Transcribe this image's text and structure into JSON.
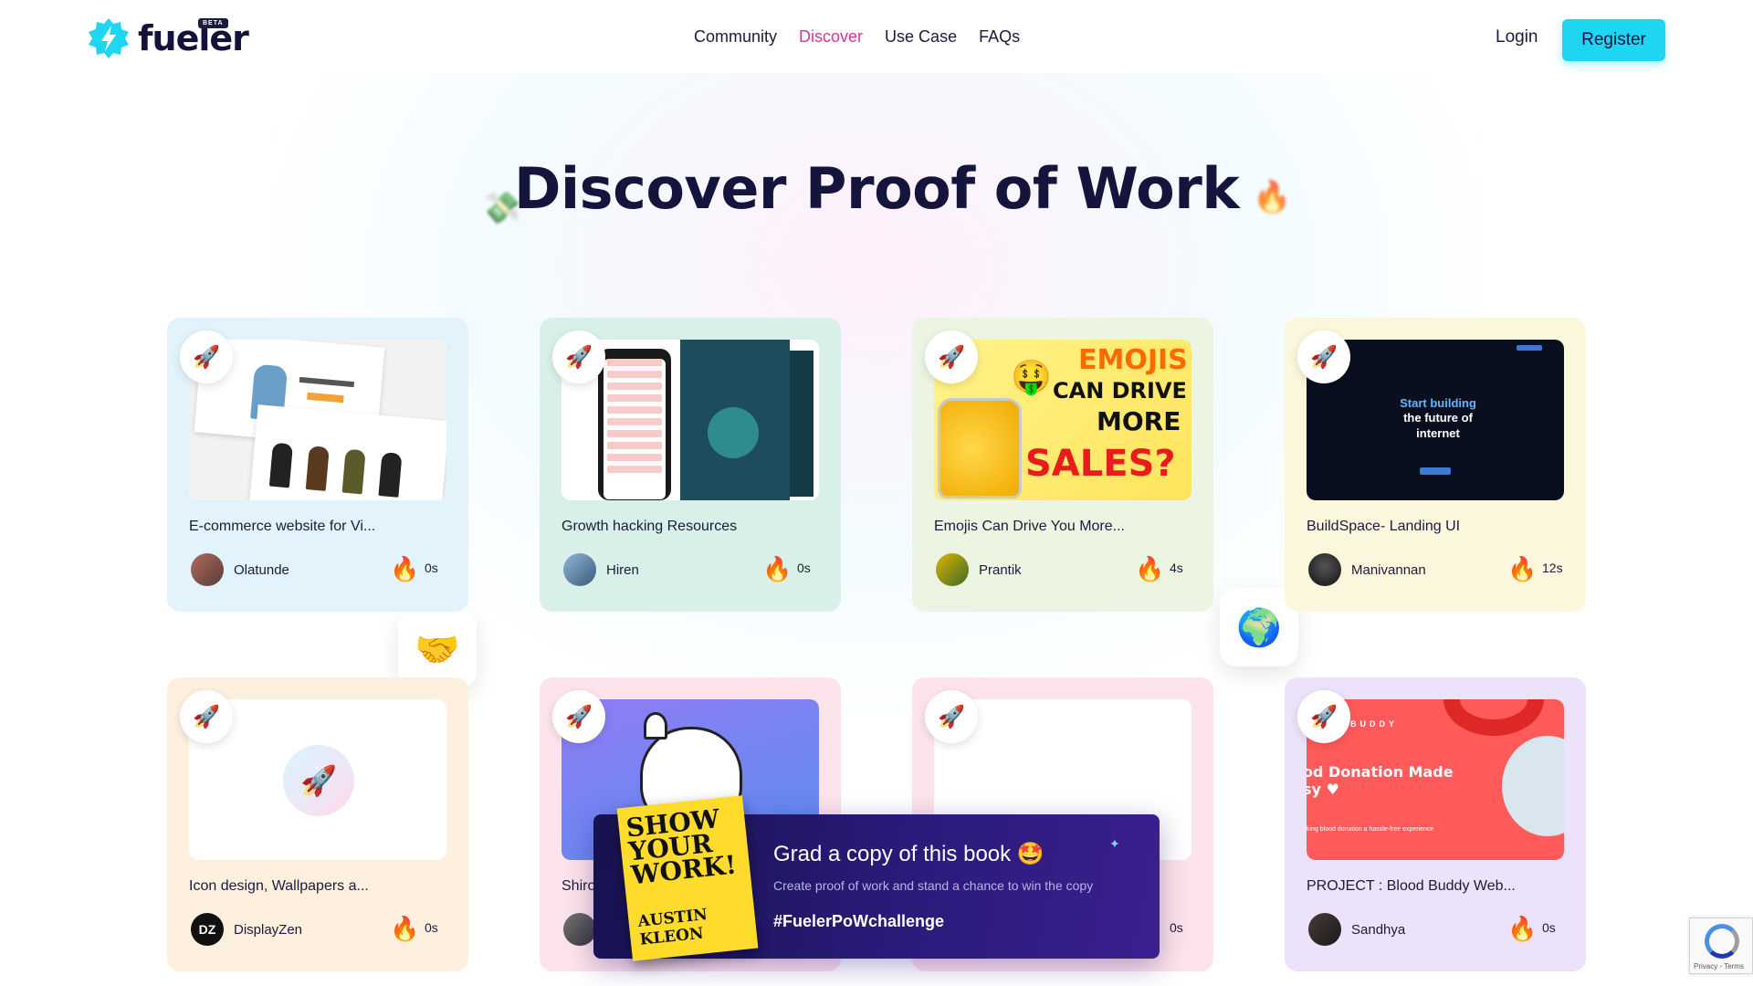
{
  "nav": {
    "logo_text": "fueler",
    "beta": "BETA",
    "links": [
      {
        "label": "Community"
      },
      {
        "label": "Discover"
      },
      {
        "label": "Use Case"
      },
      {
        "label": "FAQs"
      }
    ],
    "active_link": "Discover",
    "login": "Login",
    "register": "Register"
  },
  "hero": {
    "title": "Discover Proof of Work"
  },
  "colors": {
    "accent_cyan": "#1ed6f2",
    "active_pink": "#d8329b",
    "title_navy": "#14143c"
  },
  "cards": [
    {
      "title": "E-commerce website for Vi...",
      "author": "Olatunde",
      "count": "0s",
      "bg": "#e3f3fc",
      "icon": "rocket-icon"
    },
    {
      "title": "Growth hacking Resources",
      "author": "Hiren",
      "count": "0s",
      "bg": "#d9f0e8",
      "icon": "rocket-icon"
    },
    {
      "title": "Emojis Can Drive You More...",
      "author": "Prantik",
      "count": "4s",
      "bg": "#ebf5e2",
      "icon": "rocket-icon"
    },
    {
      "title": "BuildSpace- Landing UI",
      "author": "Manivannan",
      "count": "12s",
      "bg": "#fbf7dc",
      "icon": "rocket-icon"
    },
    {
      "title": "Icon design, Wallpapers a...",
      "author": "DisplayZen",
      "count": "0s",
      "bg": "#fef0df",
      "icon": "rocket-icon"
    },
    {
      "title": "Shiro",
      "author": "",
      "count": "",
      "bg": "#fde3ea",
      "icon": "rocket-icon"
    },
    {
      "title": "",
      "author": "",
      "count": "0s",
      "bg": "#fde3ea",
      "icon": "rocket-icon"
    },
    {
      "title": "PROJECT : Blood Buddy Web...",
      "author": "Sandhya",
      "count": "0s",
      "bg": "#ece3fb",
      "icon": "rocket-icon"
    }
  ],
  "thumbs": {
    "emoji_line1": "EMOJIS",
    "emoji_line2": "CAN DRIVE",
    "emoji_line3": "MORE",
    "emoji_line4": "SALES?",
    "buildspace_line1": "Start building",
    "buildspace_line2": "the future of",
    "buildspace_line3": "internet",
    "blood_brand": "BUDDY",
    "blood_title": "od Donation Made",
    "blood_title2": "sy ♥",
    "blood_small": "king blood donation a hassle-free experience",
    "dz_logo": "DZ"
  },
  "promo": {
    "book_title": "SHOW YOUR WORK!",
    "book_author": "AUSTIN KLEON",
    "title": "Grad a copy of this book 🤩",
    "subtitle": "Create proof of work and stand a chance to win the copy",
    "hashtag": "#FuelerPoWchallenge"
  },
  "recaptcha": {
    "links": "Privacy - Terms"
  }
}
